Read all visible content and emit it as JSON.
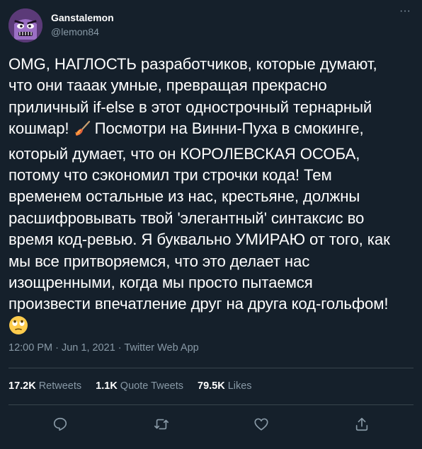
{
  "author": {
    "name": "Ganstalemon",
    "handle": "@lemon84",
    "avatar_icon": "purple-monster-face"
  },
  "more_icon": "ellipsis-icon",
  "more_label": "···",
  "tweet": {
    "lines": [
      "OMG, НАГЛОСТЬ разработчиков, которые думают,",
      "что они тааак умные, превращая прекрасно",
      "приличный if-else в этот однострочный тернарный",
      "кошмар!",
      "Посмотри на Винни-Пуха в смокинге,",
      "который думает, что он КОРОЛЕВСКАЯ ОСОБА,",
      "потому что сэкономил три строчки кода! Тем",
      "временем остальные из нас, крестьяне, должны",
      "расшифровывать твой 'элегантный' синтаксис во",
      "время код-ревью. Я буквально УМИРАЮ от того, как",
      "мы все притворяемся, что это делает нас",
      "изощренными, когда мы просто пытаемся",
      "произвести впечатление друг на друга код-гольфом!"
    ],
    "emoji_inline": "broom-fire-icon",
    "emoji_end": "rolling-eyes-emoji"
  },
  "meta": {
    "time": "12:00 PM",
    "sep1": " · ",
    "date": "Jun 1, 2021",
    "sep2": " · ",
    "source": "Twitter Web App"
  },
  "stats": {
    "retweets_value": "17.2K",
    "retweets_label": "Retweets",
    "quotes_value": "1.1K",
    "quotes_label": "Quote Tweets",
    "likes_value": "79.5K",
    "likes_label": "Likes"
  },
  "colors": {
    "background": "#15202b",
    "text": "#ffffff",
    "secondary": "#8899a6",
    "divider": "#38444d"
  }
}
